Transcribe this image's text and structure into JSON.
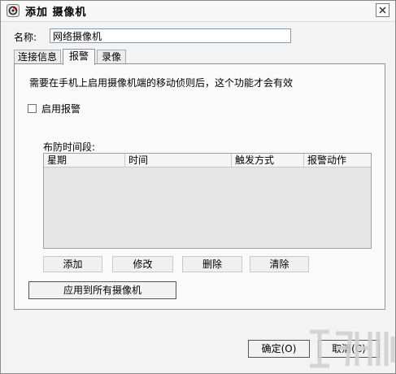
{
  "window": {
    "title": "添加 摄像机",
    "close_icon": "close-icon"
  },
  "form": {
    "name_label": "名称:",
    "name_value": "网络摄像机"
  },
  "tabs": [
    {
      "label": "连接信息",
      "active": false
    },
    {
      "label": "报警",
      "active": true
    },
    {
      "label": "录像",
      "active": false
    }
  ],
  "alarm": {
    "notice": "需要在手机上启用摄像机端的移动侦则后，这个功能才会有效",
    "enable_checkbox": {
      "label": "启用报警",
      "checked": false
    },
    "schedule_label": "布防时间段:",
    "table": {
      "headers": [
        "星期",
        "时间",
        "触发方式",
        "报警动作"
      ],
      "rows": []
    },
    "buttons": {
      "add": "添加",
      "edit": "修改",
      "delete": "删除",
      "clear": "清除"
    },
    "apply_all": "应用到所有摄像机"
  },
  "footer": {
    "ok": "确定(O)",
    "cancel": "取消(C)"
  },
  "colors": {
    "window_bg": "#f3f3f3",
    "panel_bg": "#fafafa",
    "table_bg": "#e5e5e5",
    "input_border": "#7f9db9"
  }
}
